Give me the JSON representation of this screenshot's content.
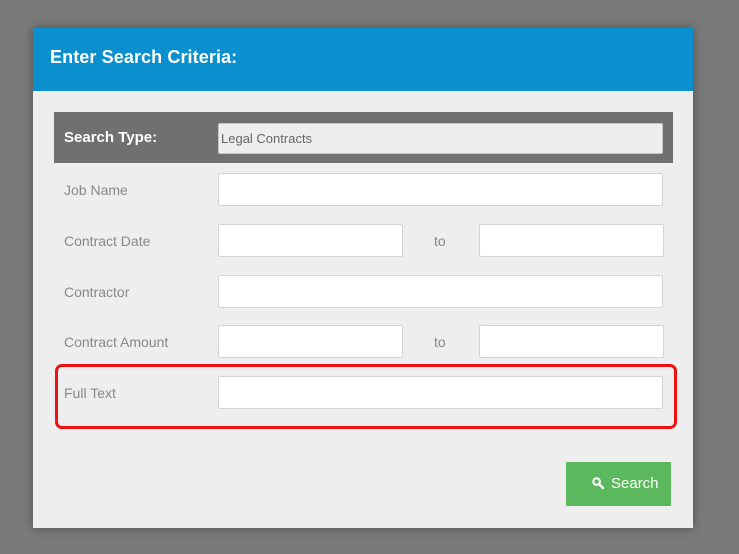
{
  "dialog": {
    "title": "Enter Search Criteria:"
  },
  "search_type": {
    "label": "Search Type:",
    "value": "Legal Contracts"
  },
  "fields": {
    "job_name": {
      "label": "Job Name",
      "value": ""
    },
    "contract_date": {
      "label": "Contract Date",
      "from_value": "",
      "to_label": "to",
      "to_value": ""
    },
    "contractor": {
      "label": "Contractor",
      "value": ""
    },
    "contract_amount": {
      "label": "Contract Amount",
      "from_value": "",
      "to_label": "to",
      "to_value": ""
    },
    "full_text": {
      "label": "Full Text",
      "value": ""
    }
  },
  "actions": {
    "search_label": "Search",
    "search_icon": "search-icon"
  },
  "colors": {
    "header": "#0b8fcf",
    "search_type_bar": "#707070",
    "search_button": "#5cb85c",
    "highlight": "#ee1111",
    "backdrop": "#7a7a7a",
    "dialog_background": "#eeeeee"
  }
}
